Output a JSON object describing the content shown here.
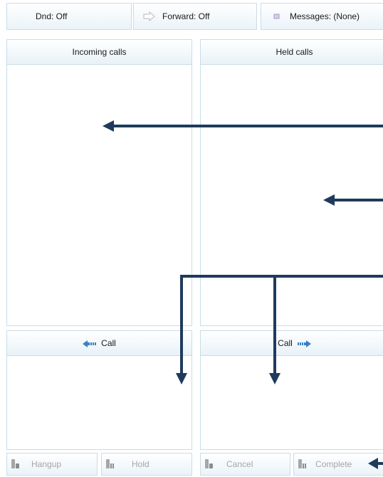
{
  "toolbar": {
    "dnd_label": "Dnd: Off",
    "forward_label": "Forward: Off",
    "messages_label": "Messages: (None)"
  },
  "panels": {
    "incoming_title": "Incoming calls",
    "held_title": "Held calls",
    "call_left_label": "Call",
    "call_right_label": "Call"
  },
  "actions": {
    "hangup": "Hangup",
    "hold": "Hold",
    "cancel": "Cancel",
    "complete": "Complete"
  },
  "icons": {
    "forward": "forward-arrow-icon",
    "messages": "message-square-icon",
    "call_left": "call-left-arrow-icon",
    "call_right": "call-right-arrow-icon",
    "phone": "phone-handset-icon"
  },
  "colors": {
    "border": "#c9dce8",
    "annotation_arrow": "#1f3a5c",
    "call_arrow": "#3a7fc4"
  }
}
